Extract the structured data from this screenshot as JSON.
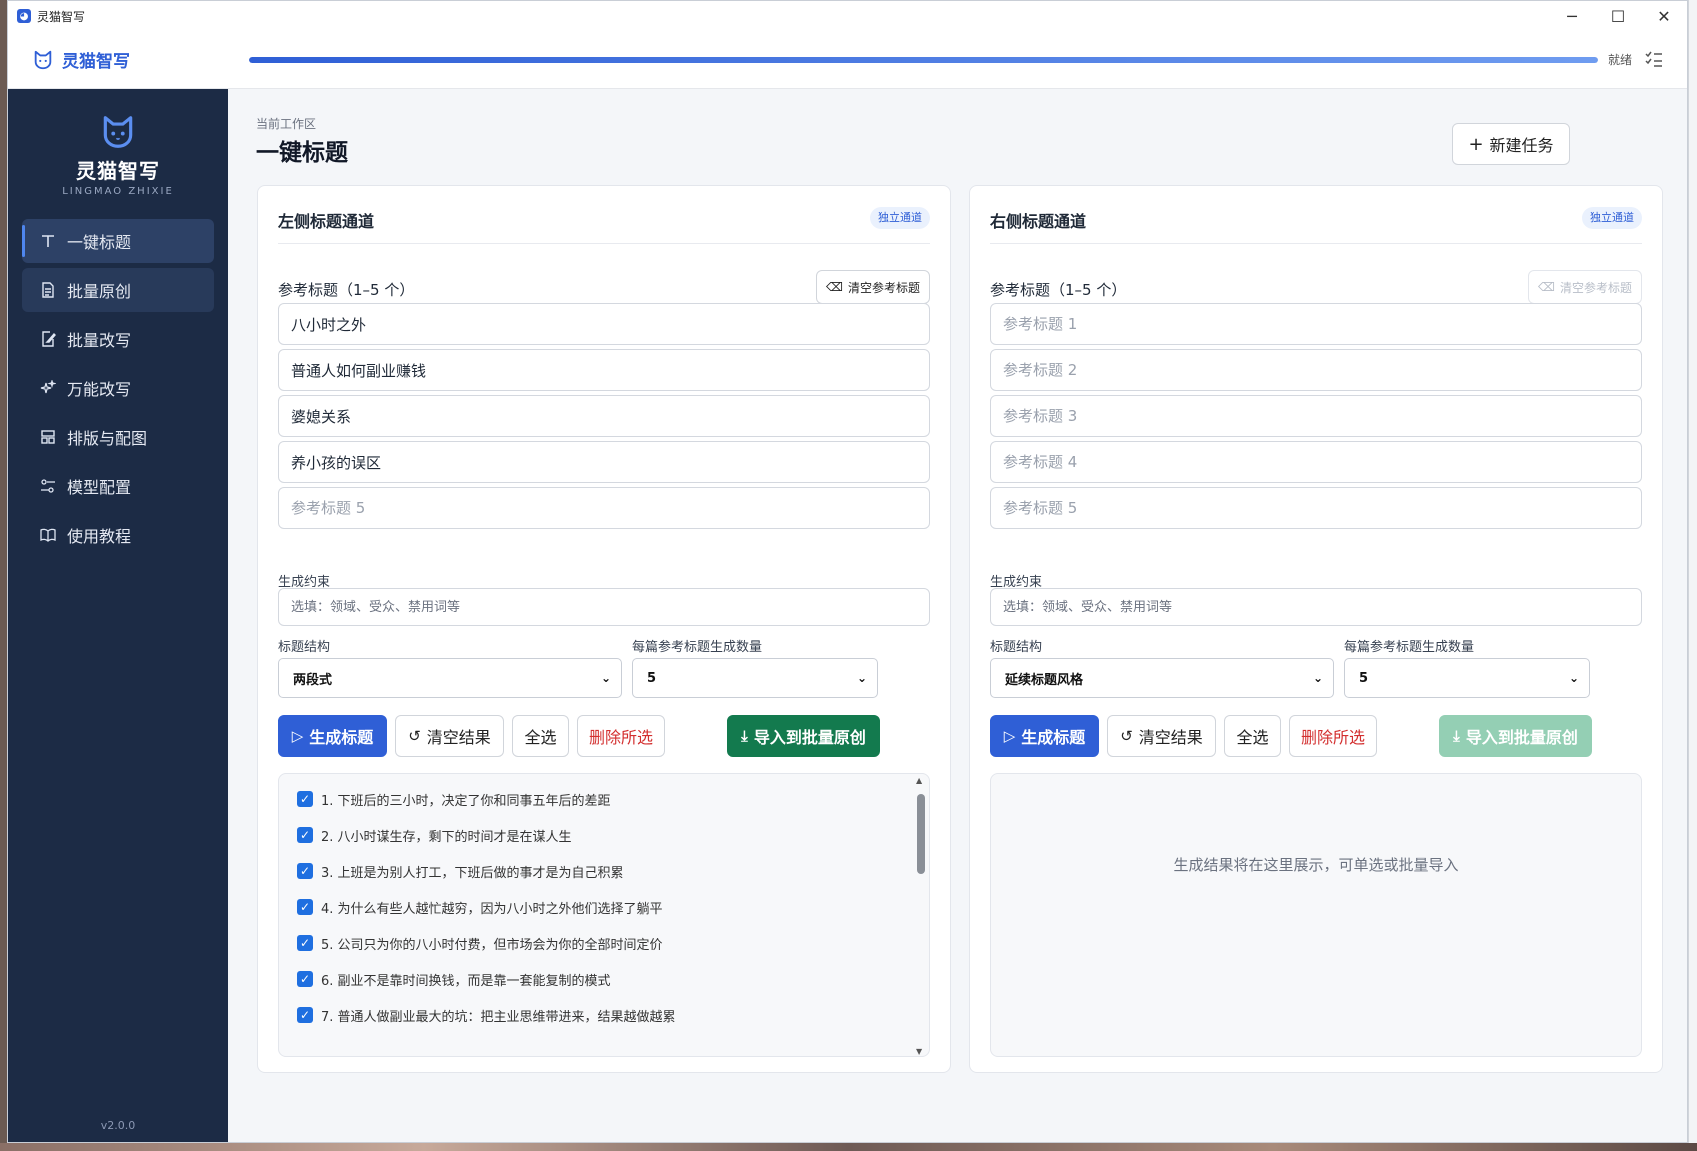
{
  "window": {
    "title": "灵猫智写"
  },
  "header": {
    "brand": "灵猫智写",
    "progress": 1.0,
    "status": "就绪"
  },
  "sidebar": {
    "name": "灵猫智写",
    "name_en": "LINGMAO ZHIXIE",
    "items": [
      {
        "label": "一键标题",
        "icon": "text-icon"
      },
      {
        "label": "批量原创",
        "icon": "document-icon"
      },
      {
        "label": "批量改写",
        "icon": "edit-document-icon"
      },
      {
        "label": "万能改写",
        "icon": "sparkle-icon"
      },
      {
        "label": "排版与配图",
        "icon": "layout-icon"
      },
      {
        "label": "模型配置",
        "icon": "sliders-icon"
      },
      {
        "label": "使用教程",
        "icon": "book-icon"
      }
    ],
    "version": "v2.0.0"
  },
  "main": {
    "breadcrumb": "当前工作区",
    "title": "一键标题",
    "new_task": "新建任务"
  },
  "left": {
    "title": "左侧标题通道",
    "badge": "独立通道",
    "ref_label": "参考标题（1–5 个）",
    "clear_ref": "清空参考标题",
    "refs": [
      "八小时之外",
      "普通人如何副业赚钱",
      "婆媳关系",
      "养小孩的误区",
      ""
    ],
    "ref_placeholders": [
      "参考标题 1",
      "参考标题 2",
      "参考标题 3",
      "参考标题 4",
      "参考标题 5"
    ],
    "constraint_label": "生成约束",
    "constraint_placeholder": "选填：领域、受众、禁用词等",
    "structure_label": "标题结构",
    "structure_value": "两段式",
    "count_label": "每篇参考标题生成数量",
    "count_value": "5",
    "btn_generate": "生成标题",
    "btn_clear": "清空结果",
    "btn_select_all": "全选",
    "btn_delete": "删除所选",
    "btn_import": "导入到批量原创",
    "results": [
      "1. 下班后的三小时，决定了你和同事五年后的差距",
      "2. 八小时谋生存，剩下的时间才是在谋人生",
      "3. 上班是为别人打工，下班后做的事才是为自己积累",
      "4. 为什么有些人越忙越穷，因为八小时之外他们选择了躺平",
      "5. 公司只为你的八小时付费，但市场会为你的全部时间定价",
      "6. 副业不是靠时间换钱，而是靠一套能复制的模式",
      "7. 普通人做副业最大的坑：把主业思维带进来，结果越做越累"
    ]
  },
  "right": {
    "title": "右侧标题通道",
    "badge": "独立通道",
    "ref_label": "参考标题（1–5 个）",
    "clear_ref": "清空参考标题",
    "refs": [
      "",
      "",
      "",
      "",
      ""
    ],
    "ref_placeholders": [
      "参考标题 1",
      "参考标题 2",
      "参考标题 3",
      "参考标题 4",
      "参考标题 5"
    ],
    "constraint_label": "生成约束",
    "constraint_placeholder": "选填：领域、受众、禁用词等",
    "structure_label": "标题结构",
    "structure_value": "延续标题风格",
    "count_label": "每篇参考标题生成数量",
    "count_value": "5",
    "btn_generate": "生成标题",
    "btn_clear": "清空结果",
    "btn_select_all": "全选",
    "btn_delete": "删除所选",
    "btn_import": "导入到批量原创",
    "empty_text": "生成结果将在这里展示，可单选或批量导入"
  },
  "colors": {
    "accent": "#2f5fd6",
    "sidebar": "#1c2b45",
    "success": "#137a4e",
    "danger": "#d32f2f"
  }
}
